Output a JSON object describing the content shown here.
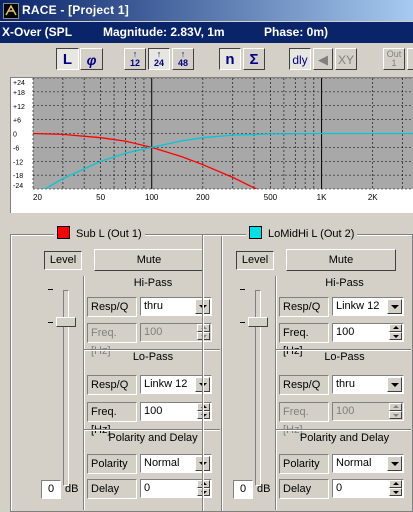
{
  "window": {
    "title": "RACE - [Project 1]"
  },
  "infobar": {
    "mode": "X-Over (SPL",
    "magnitude": "Magnitude: 2.83V, 1m",
    "phase": "Phase: 0m)"
  },
  "toolbar": {
    "btn_L": "L",
    "btn_phase": "φ",
    "btn_12_top": "↑",
    "btn_12_bot": "12",
    "btn_24_top": "↑",
    "btn_24_bot": "24",
    "btn_48_top": "↑",
    "btn_48_bot": "48",
    "btn_n": "n",
    "btn_sigma": "Σ",
    "btn_dly": "dly",
    "btn_speaker": "◀",
    "btn_xy": "XY",
    "btn_out_top": "Out",
    "btn_out_bot": "1"
  },
  "chart_data": {
    "type": "line",
    "y_tick_labels": [
      "+24",
      "+18",
      "+12",
      "+6",
      "0",
      "-6",
      "-12",
      "-18",
      "-24"
    ],
    "x_tick_labels": [
      "20",
      "50",
      "100",
      "200",
      "500",
      "1K",
      "2K"
    ],
    "x_scale": "log",
    "xlim": [
      20,
      3500
    ],
    "ylim": [
      -24,
      24
    ],
    "grid": true,
    "series": [
      {
        "color": "#ff0000",
        "x": [
          20,
          30,
          50,
          70,
          100,
          150,
          200,
          300,
          500
        ],
        "y": [
          0,
          -0.4,
          -1.8,
          -3.3,
          -6,
          -10,
          -13.5,
          -19,
          -27
        ]
      },
      {
        "color": "#00c8d8",
        "x": [
          20,
          30,
          50,
          70,
          100,
          150,
          200,
          300,
          500,
          1000,
          3500
        ],
        "y": [
          -27,
          -19.5,
          -12,
          -8.5,
          -6,
          -3.2,
          -1.8,
          -0.7,
          -0.2,
          0,
          0
        ]
      }
    ]
  },
  "channels": [
    {
      "title": "Sub L (Out 1)",
      "color": "#ff0000",
      "level_label": "Level",
      "mute_label": "Mute",
      "level_value": "0",
      "db_label": "dB",
      "hipass": {
        "title": "Hi-Pass",
        "resp_label": "Resp/Q",
        "resp_value": "thru",
        "freq_label": "Freq.[Hz]",
        "freq_value": "100",
        "disabled": true
      },
      "lopass": {
        "title": "Lo-Pass",
        "resp_label": "Resp/Q",
        "resp_value": "Linkw 12",
        "freq_label": "Freq.[Hz]",
        "freq_value": "100",
        "disabled": false
      },
      "poldelay": {
        "title": "Polarity and Delay",
        "pol_label": "Polarity",
        "pol_value": "Normal",
        "delay_label": "Delay",
        "delay_value": "0"
      }
    },
    {
      "title": "LoMidHi L (Out 2)",
      "color": "#00e0e8",
      "level_label": "Level",
      "mute_label": "Mute",
      "level_value": "0",
      "db_label": "dB",
      "hipass": {
        "title": "Hi-Pass",
        "resp_label": "Resp/Q",
        "resp_value": "Linkw 12",
        "freq_label": "Freq.[Hz]",
        "freq_value": "100",
        "disabled": false
      },
      "lopass": {
        "title": "Lo-Pass",
        "resp_label": "Resp/Q",
        "resp_value": "thru",
        "freq_label": "Freq.[Hz]",
        "freq_value": "100",
        "disabled": true
      },
      "poldelay": {
        "title": "Polarity and Delay",
        "pol_label": "Polarity",
        "pol_value": "Normal",
        "delay_label": "Delay",
        "delay_value": "0"
      }
    }
  ]
}
